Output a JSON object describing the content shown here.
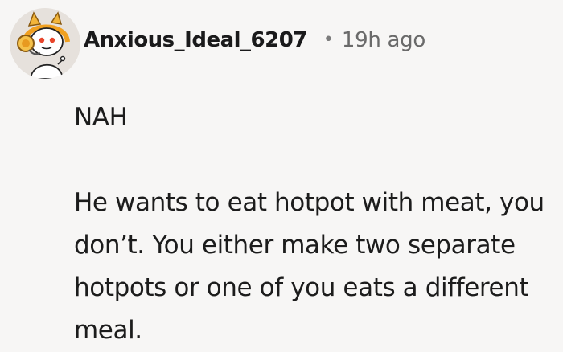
{
  "comment": {
    "avatar": {
      "icon": "snoo-avatar-icon",
      "accent": "#f0a020",
      "headphone_color": "#f0b030"
    },
    "author": "Anxious_Ideal_6207",
    "separator": "•",
    "timestamp": "19h ago",
    "paragraphs": [
      "NAH",
      "He wants to eat hotpot with meat, you don’t. You either make two separate hotpots or one of you eats a different meal."
    ]
  }
}
